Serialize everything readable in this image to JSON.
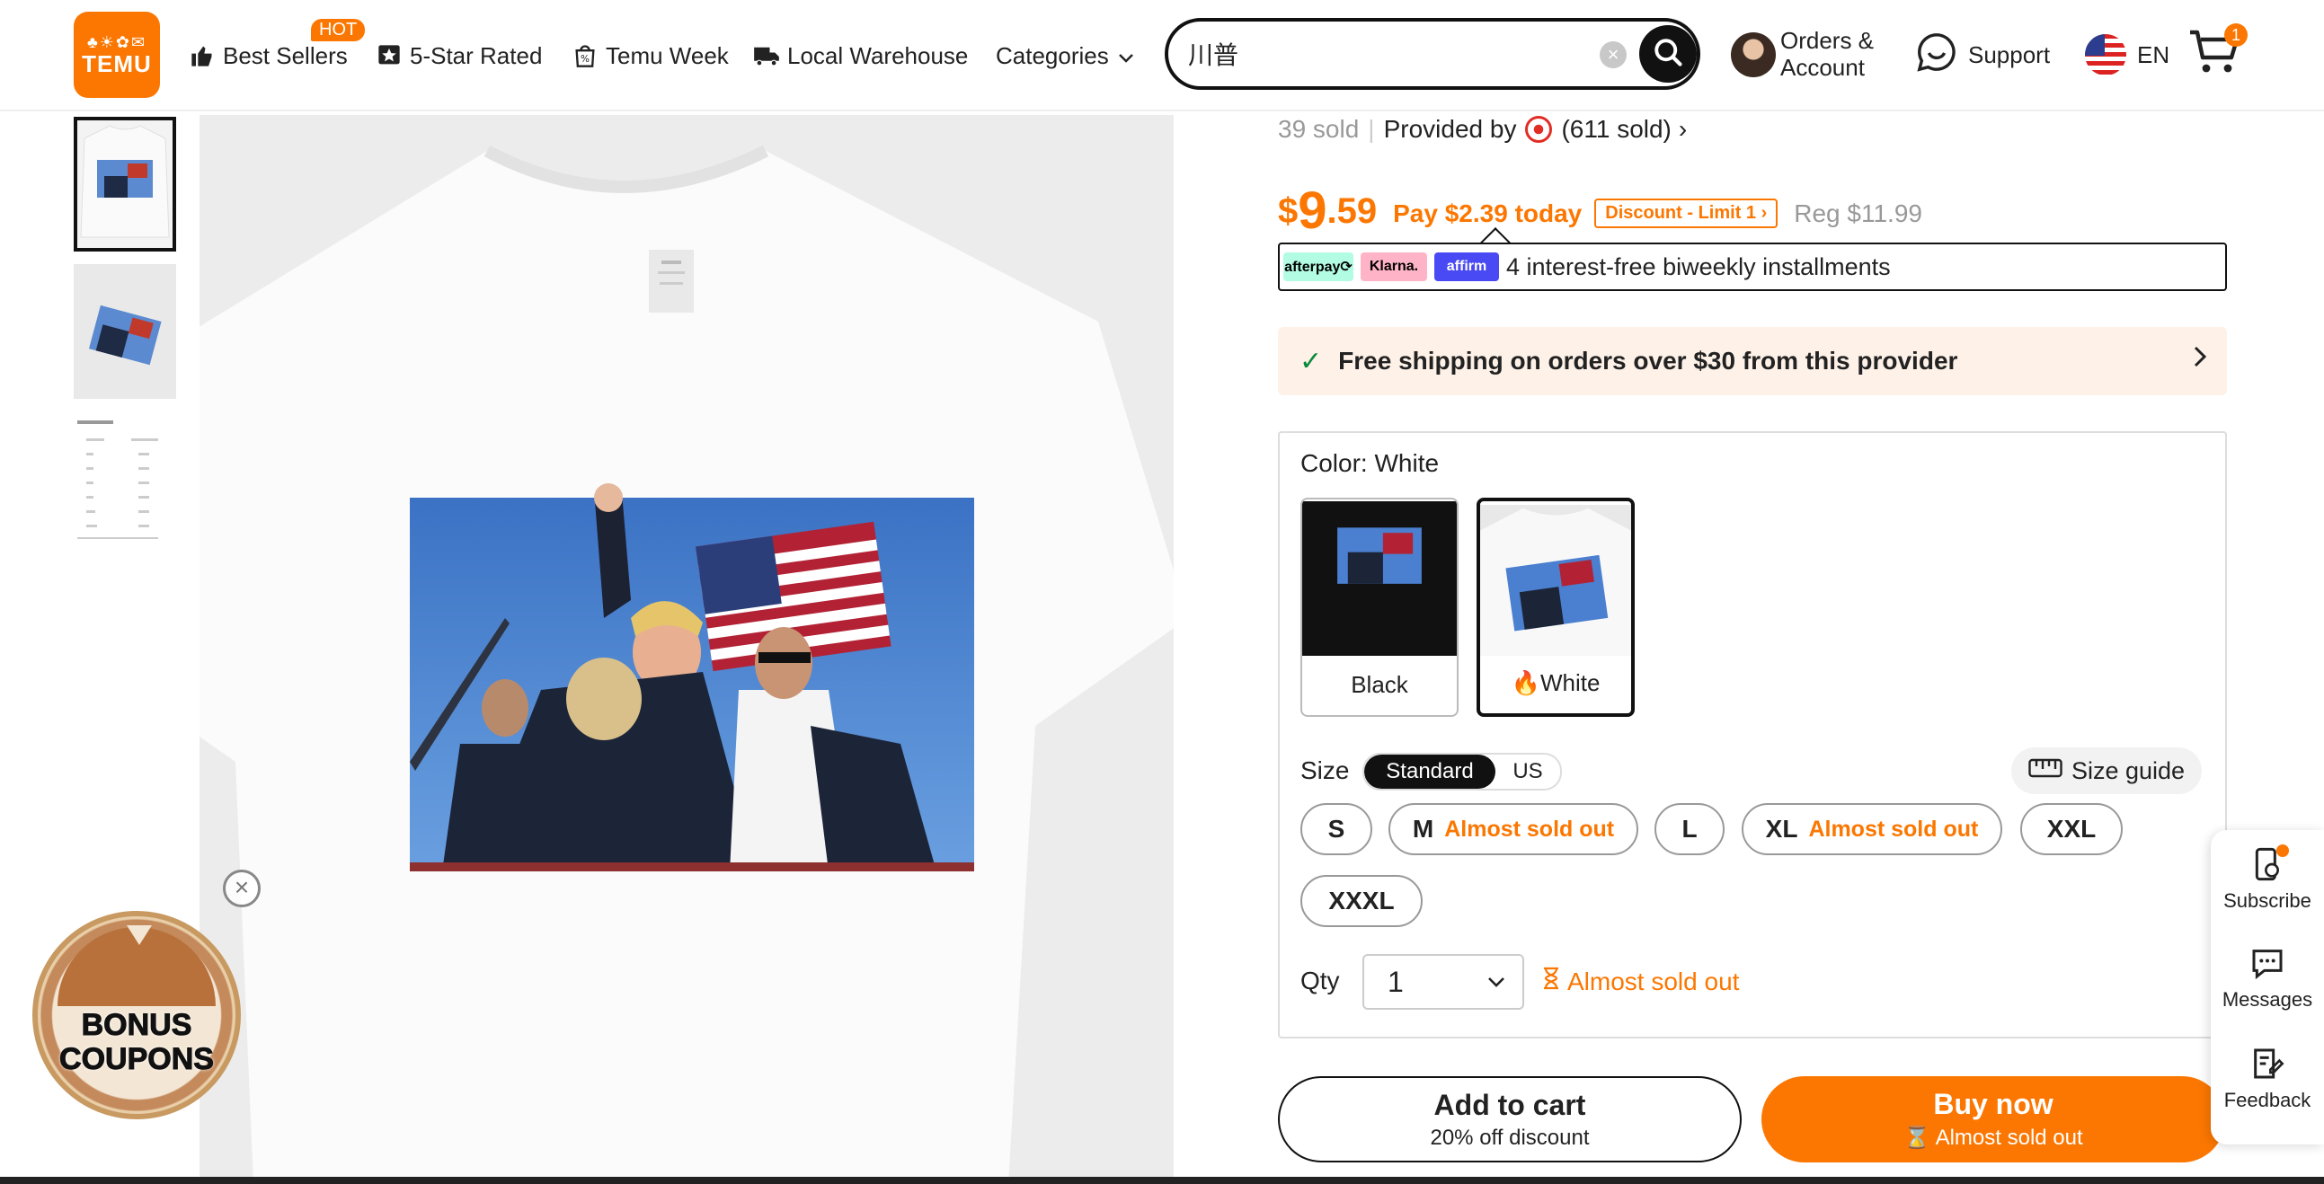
{
  "header": {
    "logo": {
      "glyphs": "♣☀✿✉",
      "text": "TEMU"
    },
    "nav": [
      {
        "label": "Best Sellers",
        "icon": "thumbs-up-icon"
      },
      {
        "label": "5-Star Rated",
        "icon": "star-badge-icon"
      },
      {
        "label": "Temu Week",
        "icon": "shopping-bag-icon"
      },
      {
        "label": "Local Warehouse",
        "icon": "truck-icon"
      },
      {
        "label": "Categories",
        "icon": "chevron-down-icon"
      }
    ],
    "hot_badge": "HOT",
    "search": {
      "value": "川普"
    },
    "orders_line1": "Orders &",
    "orders_line2": "Account",
    "support": "Support",
    "language": "EN",
    "cart_count": "1"
  },
  "product": {
    "sold": "39 sold",
    "provided_by": "Provided by",
    "provider_sold": "(611 sold)",
    "price": {
      "currency": "$",
      "integer": "9",
      "decimal": ".59"
    },
    "pay_today": "Pay $2.39 today",
    "discount_badge": "Discount - Limit 1",
    "regular": "Reg $11.99",
    "installments": {
      "providers": [
        "afterpay⟳",
        "Klarna.",
        "affirm"
      ],
      "text": "4 interest-free biweekly installments"
    },
    "shipping": "Free shipping on orders over $30 from this provider",
    "color_label": "Color: White",
    "colors": [
      {
        "label": "Black",
        "selected": false
      },
      {
        "label": "White",
        "selected": true
      }
    ],
    "size_label": "Size",
    "size_modes": [
      "Standard",
      "US"
    ],
    "size_guide": "Size guide",
    "sizes": [
      {
        "label": "S",
        "note": ""
      },
      {
        "label": "M",
        "note": "Almost sold out"
      },
      {
        "label": "L",
        "note": ""
      },
      {
        "label": "XL",
        "note": "Almost sold out"
      },
      {
        "label": "XXL",
        "note": ""
      },
      {
        "label": "XXXL",
        "note": ""
      }
    ],
    "qty_label": "Qty",
    "qty_value": "1",
    "qty_warning": "Almost sold out",
    "add_to_cart": {
      "title": "Add to cart",
      "sub": "20% off discount"
    },
    "buy_now": {
      "title": "Buy now",
      "sub": "Almost sold out"
    }
  },
  "side_panel": [
    {
      "label": "Subscribe",
      "icon": "subscribe-icon"
    },
    {
      "label": "Messages",
      "icon": "messages-icon"
    },
    {
      "label": "Feedback",
      "icon": "feedback-icon"
    }
  ],
  "bonus_coupons": {
    "line1": "BONUS",
    "line2": "COUPONS"
  },
  "colors": {
    "brand": "#fb7701",
    "text": "#222222",
    "success": "#0a8a3a",
    "shipping_bg": "#fdf1e8"
  }
}
